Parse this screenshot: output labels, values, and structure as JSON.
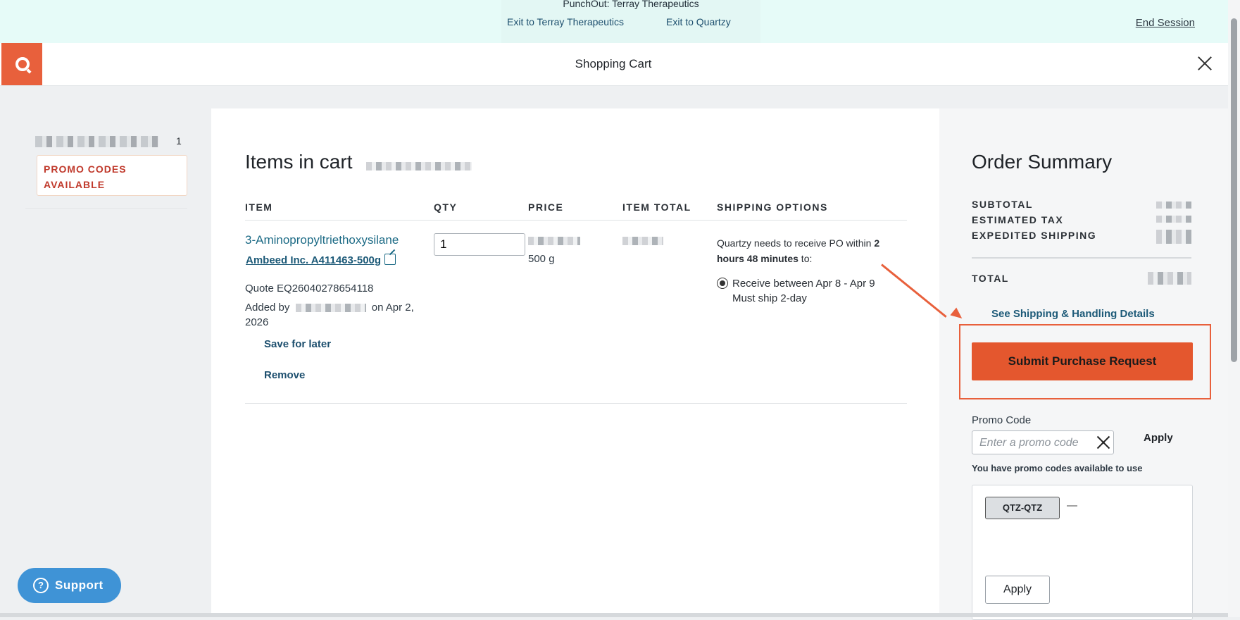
{
  "banner": {
    "title": "PunchOut: Terray Therapeutics",
    "exit_terray": "Exit to Terray Therapeutics",
    "exit_quartzy": "Exit to Quartzy",
    "end_session": "End Session"
  },
  "header": {
    "title": "Shopping Cart"
  },
  "left_rail": {
    "count": "1",
    "promo_badge": "PROMO CODES AVAILABLE"
  },
  "cart": {
    "title": "Items in cart",
    "columns": [
      "ITEM",
      "QTY",
      "PRICE",
      "ITEM TOTAL",
      "SHIPPING OPTIONS"
    ],
    "item": {
      "name": "3-Aminopropyltriethoxysilane",
      "vendor": "Ambeed Inc. A411463-500g",
      "quote": "Quote EQ26040278654118",
      "added_prefix": "Added by",
      "added_suffix": "on Apr 2, 2026",
      "save_for_later": "Save for later",
      "remove": "Remove",
      "qty": "1",
      "size": "500 g",
      "ship_note_1": "Quartzy needs to receive PO within ",
      "ship_note_bold": "2 hours 48 minutes",
      "ship_note_2": " to:",
      "ship_option_line1": "Receive between Apr 8 - Apr 9",
      "ship_option_line2": "Must ship 2-day"
    }
  },
  "summary": {
    "title": "Order Summary",
    "subtotal_label": "SUBTOTAL",
    "tax_label": "ESTIMATED TAX",
    "shipping_label": "EXPEDITED SHIPPING",
    "total_label": "TOTAL",
    "see_details": "See Shipping & Handling Details",
    "submit": "Submit Purchase Request",
    "promo_label": "Promo Code",
    "promo_placeholder": "Enter a promo code",
    "promo_apply": "Apply",
    "promo_note": "You have promo codes available to use",
    "promo_chip": "QTZ-QTZ",
    "promo_chip_dash": "—",
    "panel_apply": "Apply"
  },
  "support": {
    "label": "Support",
    "icon": "?"
  },
  "colors": {
    "brand": "#e8603c",
    "banner": "#e6fbf8",
    "link": "#1d6b86",
    "support": "#3f93d6"
  }
}
